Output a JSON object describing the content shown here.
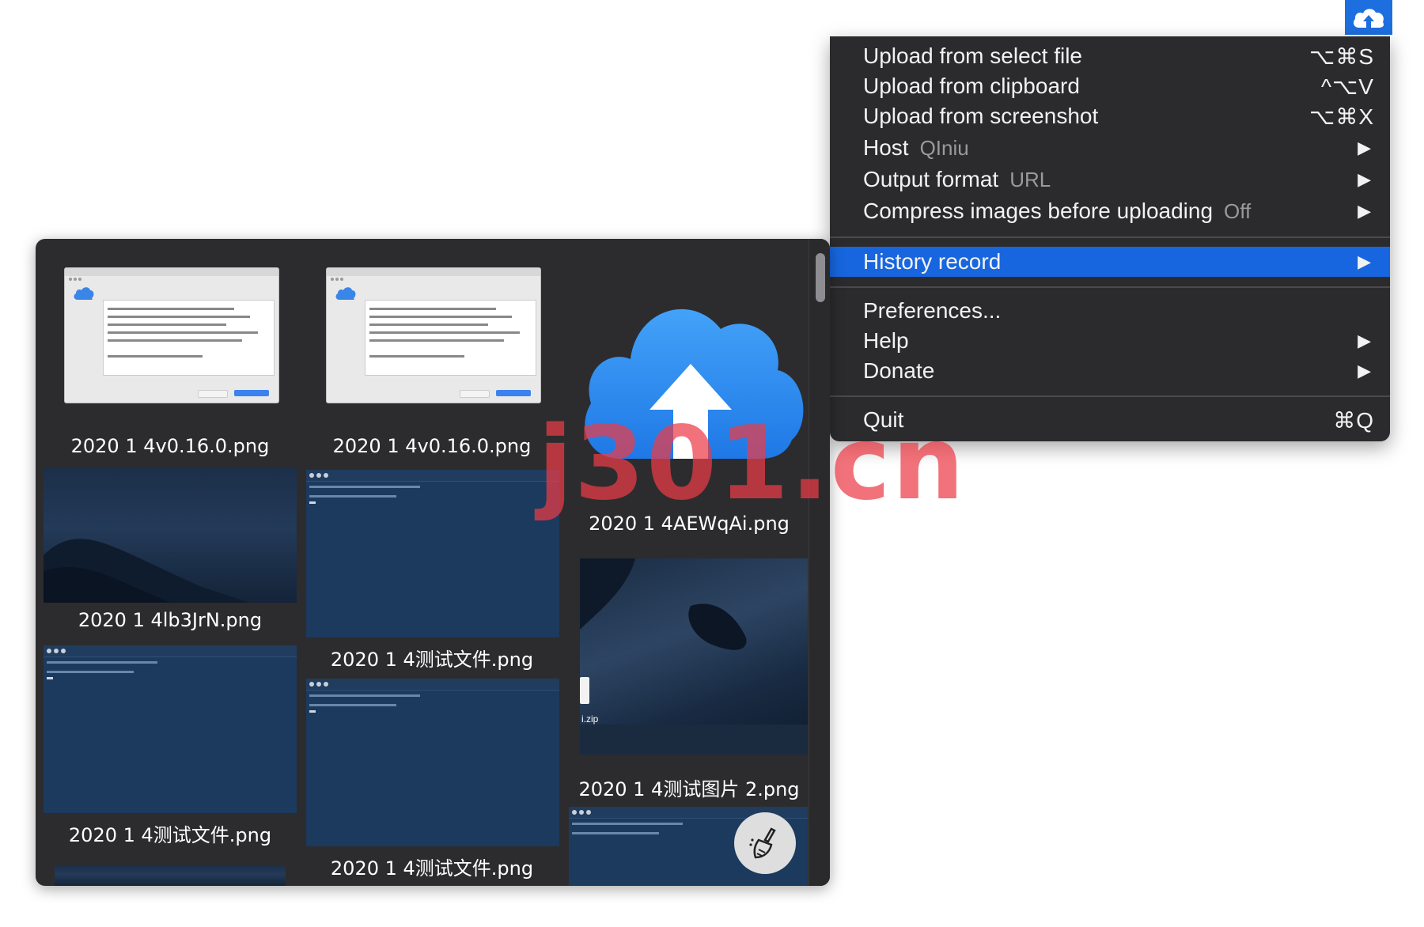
{
  "status_bar": {
    "icon": "cloud-upload-icon",
    "accent": "#1d6fe0"
  },
  "menu": {
    "items": [
      {
        "label": "Upload from select file",
        "shortcut": "⌥⌘S"
      },
      {
        "label": "Upload from clipboard",
        "shortcut": "^⌥V"
      },
      {
        "label": "Upload from screenshot",
        "shortcut": "⌥⌘X"
      },
      {
        "label": "Host",
        "value": "QIniu"
      },
      {
        "label": "Output format",
        "value": "URL"
      },
      {
        "label": "Compress images before uploading",
        "value": "Off"
      },
      {
        "label": "History record"
      },
      {
        "label": "Preferences..."
      },
      {
        "label": "Help"
      },
      {
        "label": "Donate"
      },
      {
        "label": "Quit",
        "shortcut": "⌘Q"
      }
    ],
    "submenu_arrow": "▶",
    "highlight_color": "#1766df"
  },
  "history": {
    "items": [
      {
        "caption": "2020 1 4v0.16.0.png"
      },
      {
        "caption": "2020 1 4v0.16.0.png"
      },
      {
        "caption": "2020 1 4AEWqAi.png"
      },
      {
        "caption": "2020 1 4lb3JrN.png"
      },
      {
        "caption": "2020 1 4测试文件.png"
      },
      {
        "caption": "2020 1 4测试图片 2.png"
      },
      {
        "caption": "2020 1 4测试文件.png"
      },
      {
        "caption": "2020 1 4测试文件.png"
      }
    ],
    "zip_label": "i.zip",
    "clean_icon": "broom-icon"
  },
  "watermark": "j301.cn"
}
